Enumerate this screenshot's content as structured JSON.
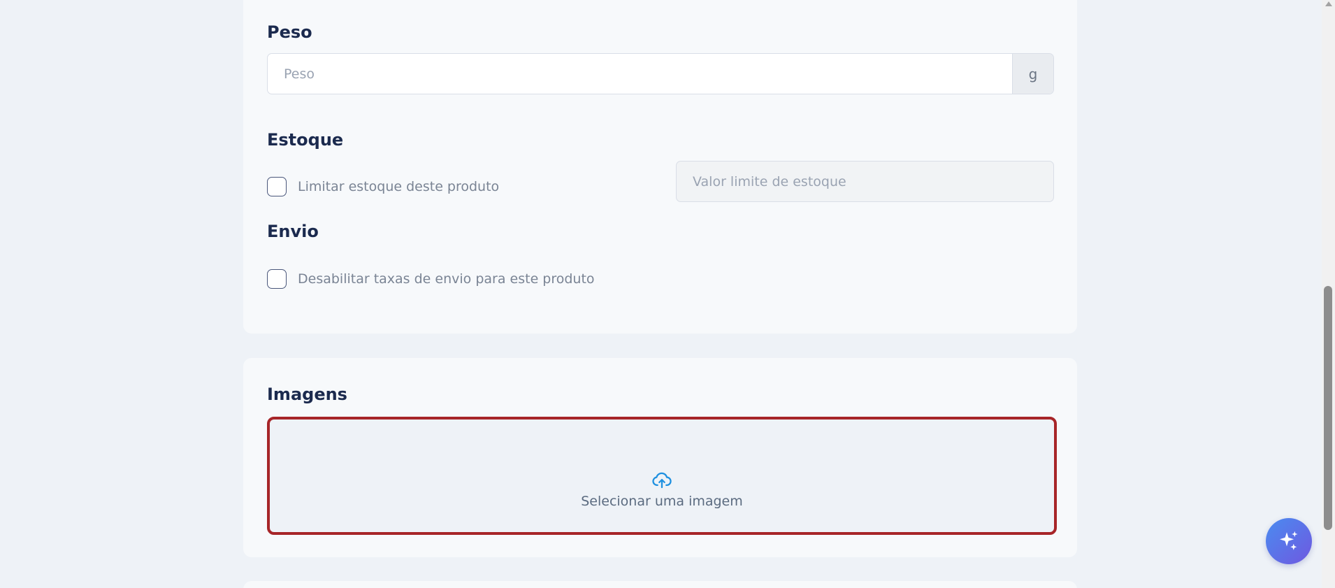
{
  "details": {
    "weight": {
      "title": "Peso",
      "placeholder": "Peso",
      "unit": "g"
    },
    "stock": {
      "title": "Estoque",
      "limit_checkbox_label": "Limitar estoque deste produto",
      "limit_placeholder": "Valor limite de estoque"
    },
    "shipping": {
      "title": "Envio",
      "disable_checkbox_label": "Desabilitar taxas de envio para este produto"
    }
  },
  "images": {
    "title": "Imagens",
    "upload_label": "Selecionar uma imagem",
    "upload_icon": "cloud-upload-icon"
  },
  "assistant": {
    "icon": "sparkles-icon"
  },
  "colors": {
    "accent_upload": "#1e90e0",
    "dropzone_border": "#a72528",
    "heading": "#1b2a4e"
  }
}
